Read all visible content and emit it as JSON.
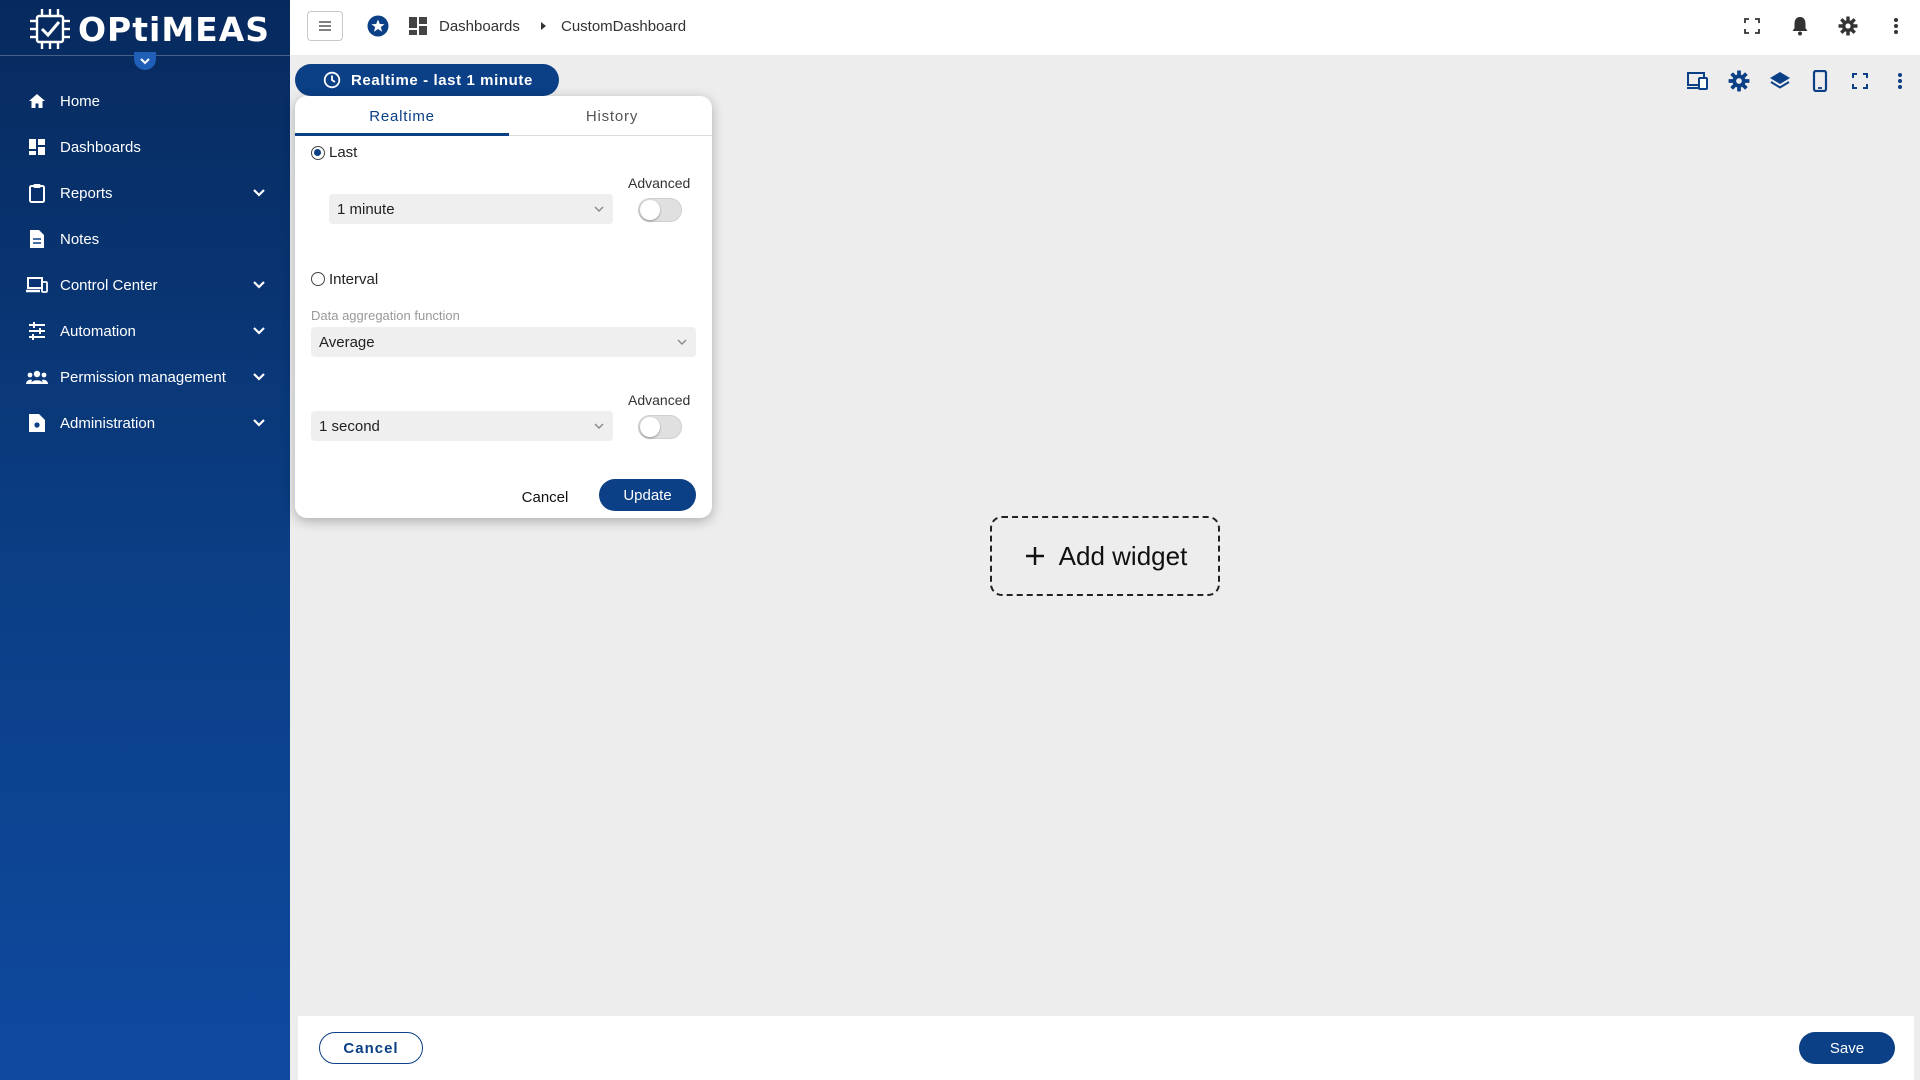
{
  "app": {
    "logo_text": "OPtiMEAS"
  },
  "sidebar": {
    "items": [
      {
        "label": "Home",
        "icon": "home-icon",
        "expandable": false
      },
      {
        "label": "Dashboards",
        "icon": "dashboards-icon",
        "expandable": false
      },
      {
        "label": "Reports",
        "icon": "clipboard-icon",
        "expandable": true
      },
      {
        "label": "Notes",
        "icon": "note-icon",
        "expandable": false
      },
      {
        "label": "Control Center",
        "icon": "devices-icon",
        "expandable": true
      },
      {
        "label": "Automation",
        "icon": "sliders-icon",
        "expandable": true
      },
      {
        "label": "Permission management",
        "icon": "people-icon",
        "expandable": true
      },
      {
        "label": "Administration",
        "icon": "admin-doc-icon",
        "expandable": true
      }
    ]
  },
  "breadcrumb": {
    "parent": "Dashboards",
    "current": "CustomDashboard"
  },
  "toolbar": {
    "time_range_label": "Realtime - last 1 minute"
  },
  "popup": {
    "tabs": [
      "Realtime",
      "History"
    ],
    "active_tab": "Realtime",
    "last_label": "Last",
    "last_checked": true,
    "advanced_label_1": "Advanced",
    "last_value": "1 minute",
    "interval_label": "Interval",
    "interval_checked": false,
    "aggregation_label": "Data aggregation function",
    "aggregation_value": "Average",
    "advanced_label_2": "Advanced",
    "interval_value": "1 second",
    "cancel_label": "Cancel",
    "update_label": "Update"
  },
  "canvas": {
    "add_widget_label": "Add widget"
  },
  "footer": {
    "cancel_label": "Cancel",
    "save_label": "Save"
  },
  "colors": {
    "brand": "#0b3f86",
    "sidebar_top": "#072a5e",
    "background": "#ededed"
  }
}
